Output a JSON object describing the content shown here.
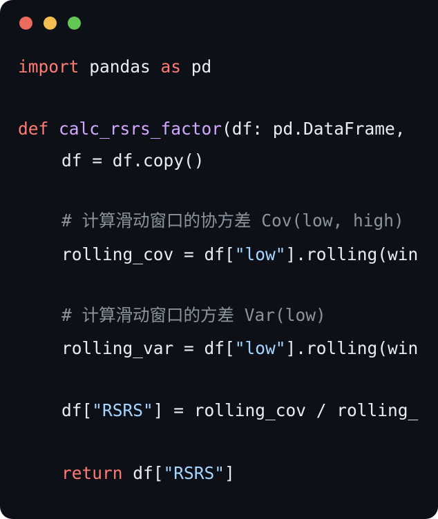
{
  "window": {
    "controls": {
      "close_color": "#ed6a5e",
      "minimize_color": "#f5bf4f",
      "maximize_color": "#62c655"
    }
  },
  "theme": {
    "background": "#0d1117",
    "keyword_color": "#ff7b72",
    "function_color": "#d2a8ff",
    "string_color": "#a5d6ff",
    "comment_color": "#8b949e",
    "text_color": "#e6edf3"
  },
  "code": {
    "import_kw": "import",
    "import_module": " pandas ",
    "import_as": "as",
    "import_alias": " pd",
    "def_kw": "def",
    "func_name": "calc_rsrs_factor",
    "func_params": "(df: pd.DataFrame,",
    "copy_line": "df = df.copy()",
    "comment_cov": "# 计算滑动窗口的协方差 Cov(low, high)",
    "cov_prefix": "rolling_cov = df[",
    "cov_str": "\"low\"",
    "cov_suffix": "].rolling(win",
    "comment_var": "# 计算滑动窗口的方差 Var(low)",
    "var_prefix": "rolling_var = df[",
    "var_str": "\"low\"",
    "var_suffix": "].rolling(win",
    "rsrs_prefix": "df[",
    "rsrs_str": "\"RSRS\"",
    "rsrs_suffix": "] = rolling_cov / rolling_",
    "return_kw": "return",
    "return_prefix": " df[",
    "return_str": "\"RSRS\"",
    "return_suffix": "]"
  }
}
